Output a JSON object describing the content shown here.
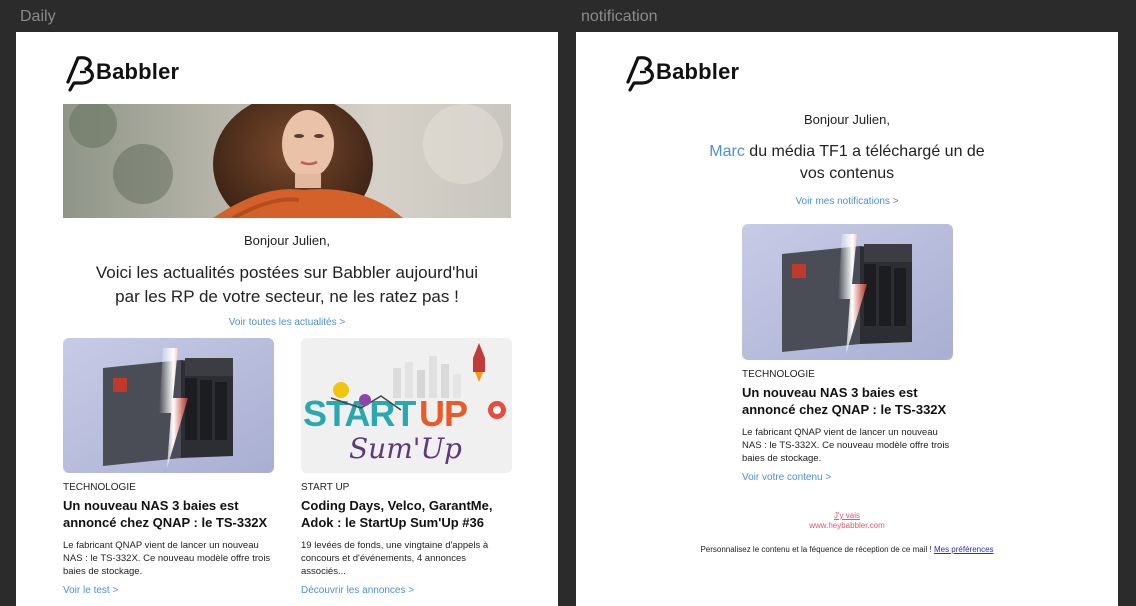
{
  "frames": {
    "daily_label": "Daily",
    "notification_label": "notification"
  },
  "brand": {
    "name": "Babbler"
  },
  "daily": {
    "greeting": "Bonjour Julien,",
    "headline_line1": "Voici les actualités postées sur Babbler aujourd'hui",
    "headline_line2": "par les RP de votre secteur, ne les ratez pas !",
    "all_news_link": "Voir toutes les actualités >",
    "cards": [
      {
        "category": "TECHNOLOGIE",
        "title": "Un nouveau NAS 3 baies est annoncé chez QNAP : le TS-332X",
        "description": "Le fabricant QNAP vient de lancer un nouveau NAS : le TS-332X. Ce nouveau modèle offre trois baies de stockage.",
        "link": "Voir le test >"
      },
      {
        "category": "START UP",
        "title": "Coding Days, Velco, GarantMe, Adok : le StartUp Sum'Up #36",
        "description": "19 levées de fonds, une vingtaine d'appels à concours et d'événements, 4 annonces associés...",
        "link": "Découvrir les annonces >"
      }
    ],
    "startup_image_text": "Sum'Up"
  },
  "notification": {
    "greeting": "Bonjour Julien,",
    "headline_name": "Marc",
    "headline_rest_line1": " du média TF1 a téléchargé un de",
    "headline_line2": "vos contenus",
    "notifications_link": "Voir mes notifications >",
    "card": {
      "category": "TECHNOLOGIE",
      "title": "Un nouveau NAS 3 baies est annoncé chez QNAP : le TS-332X",
      "description": "Le fabricant QNAP vient de lancer un nouveau NAS : le TS-332X. Ce nouveau modèle offre trois baies de stockage.",
      "link": "Voir votre contenu >"
    },
    "go_link": "J'y vais",
    "website": "www.heybabbler.com",
    "footer_text": "Personnalisez le contenu et la féquence de réception de ce mail !",
    "footer_link": "Mes préférences"
  },
  "colors": {
    "background": "#2b2b2c",
    "link_blue": "#4a90d9",
    "accent_pink": "#e05a6a"
  }
}
